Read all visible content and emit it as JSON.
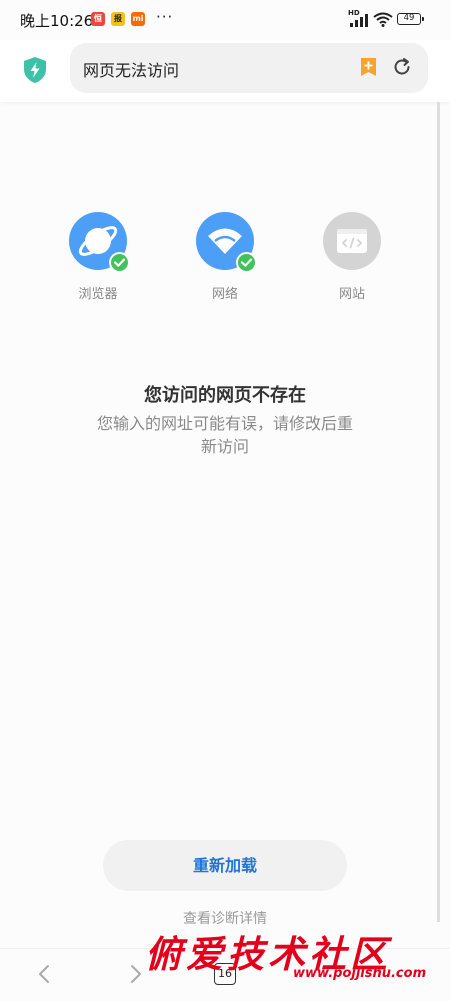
{
  "status_bar": {
    "time": "晚上10:26",
    "apps": [
      {
        "icon": "red-app-icon",
        "color": "#f0453a",
        "text": "恒"
      },
      {
        "icon": "yellow-app-icon",
        "color": "#f5c21b",
        "text": "报"
      },
      {
        "icon": "mi-icon",
        "color": "#ff6a00",
        "text": "mi"
      }
    ],
    "more": "···",
    "network_label": "HD",
    "battery": "49"
  },
  "address_bar": {
    "url_text": "网页无法访问",
    "bookmark_icon": "bookmark-add-icon",
    "reload_icon": "reload-icon",
    "shield_icon": "security-shield-icon"
  },
  "diagnostics": [
    {
      "name": "browser",
      "label": "浏览器",
      "icon": "planet-icon",
      "status": "ok",
      "color": "#4d9ef7"
    },
    {
      "name": "network",
      "label": "网络",
      "icon": "wifi-icon",
      "status": "ok",
      "color": "#4d9ef7"
    },
    {
      "name": "website",
      "label": "网站",
      "icon": "code-window-icon",
      "status": "fail",
      "color": "#d4d4d4"
    }
  ],
  "error": {
    "title": "您访问的网页不存在",
    "subtitle": "您输入的网址可能有误，请修改后重新访问"
  },
  "actions": {
    "reload_label": "重新加载",
    "details_label": "查看诊断详情"
  },
  "bottom_nav": {
    "tab_count": "16"
  },
  "watermark": {
    "text_cn": "俯爱技术社区",
    "url": "www.pojjishu.com"
  },
  "colors": {
    "accent": "#1f74d6",
    "check": "#42c25a",
    "bookmark": "#f4a52c"
  }
}
